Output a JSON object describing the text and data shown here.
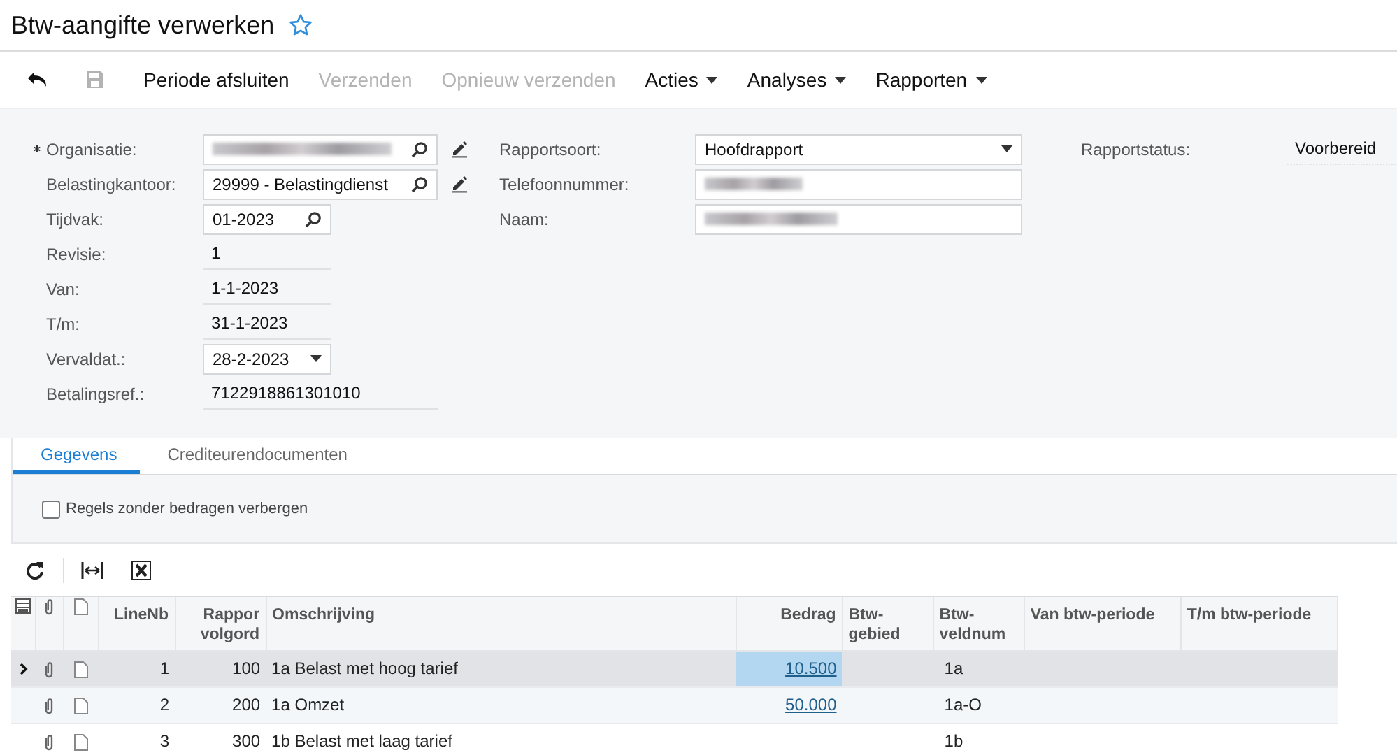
{
  "page": {
    "title": "Btw-aangifte verwerken",
    "favorite": false
  },
  "toolbar": [
    {
      "kind": "undo",
      "disabled": false
    },
    {
      "kind": "save",
      "disabled": true
    },
    {
      "kind": "button",
      "label": "Periode afsluiten",
      "disabled": false
    },
    {
      "kind": "button",
      "label": "Verzenden",
      "disabled": true
    },
    {
      "kind": "button",
      "label": "Opnieuw verzenden",
      "disabled": true
    },
    {
      "kind": "menu",
      "label": "Acties",
      "disabled": false
    },
    {
      "kind": "menu",
      "label": "Analyses",
      "disabled": false
    },
    {
      "kind": "menu",
      "label": "Rapporten",
      "disabled": false
    }
  ],
  "form": {
    "left": [
      {
        "label": "Organisatie:",
        "kind": "lookup",
        "required": true,
        "redacted": true,
        "editable": true,
        "wide": true
      },
      {
        "label": "Belastingkantoor:",
        "kind": "lookup",
        "value": "29999 - Belastingdienst",
        "required": false,
        "redacted": false,
        "editable": true,
        "wide": true
      },
      {
        "label": "Tijdvak:",
        "kind": "lookup",
        "value": "01-2023",
        "required": false,
        "redacted": false,
        "editable": false,
        "wide": false
      },
      {
        "label": "Revisie:",
        "kind": "readonly",
        "value": "1",
        "required": false,
        "redacted": false,
        "editable": false,
        "wide": false
      },
      {
        "label": "Van:",
        "kind": "readonly",
        "value": "1-1-2023",
        "required": false,
        "redacted": false,
        "editable": false,
        "wide": false
      },
      {
        "label": "T/m:",
        "kind": "readonly",
        "value": "31-1-2023",
        "required": false,
        "redacted": false,
        "editable": false,
        "wide": false
      },
      {
        "label": "Vervaldat.:",
        "kind": "select",
        "value": "28-2-2023",
        "required": false,
        "redacted": false,
        "editable": false,
        "wide": false
      },
      {
        "label": "Betalingsref.:",
        "kind": "readonly",
        "value": "7122918861301010",
        "required": false,
        "redacted": false,
        "editable": false,
        "wide": true
      }
    ],
    "middle": [
      {
        "label": "Rapportsoort:",
        "kind": "select",
        "value": "Hoofdrapport",
        "redacted": false
      },
      {
        "label": "Telefoonnummer:",
        "kind": "text",
        "redacted": true
      },
      {
        "label": "Naam:",
        "kind": "text",
        "redacted": true
      }
    ],
    "status": {
      "label": "Rapportstatus:",
      "value": "Voorbereid"
    }
  },
  "tabs": [
    {
      "label": "Gegevens",
      "selected": true
    },
    {
      "label": "Crediteurendocumenten",
      "selected": false
    }
  ],
  "filter": {
    "label": "Regels zonder bedragen verbergen",
    "checked": false
  },
  "table": {
    "columns": [
      "LineNb",
      "Rappor volgord",
      "Omschrijving",
      "Bedrag",
      "Btw-gebied",
      "Btw-veldnum",
      "Van btw-periode",
      "T/m btw-periode"
    ],
    "rows": [
      {
        "selected": true,
        "line": "1",
        "order": "100",
        "description": "1a Belast met hoog tarief",
        "amount": "10.500",
        "field": "1a"
      },
      {
        "selected": false,
        "line": "2",
        "order": "200",
        "description": "1a Omzet",
        "amount": "50.000",
        "field": "1a-O"
      },
      {
        "selected": false,
        "line": "3",
        "order": "300",
        "description": "1b Belast met laag tarief",
        "field": "1b"
      }
    ]
  }
}
